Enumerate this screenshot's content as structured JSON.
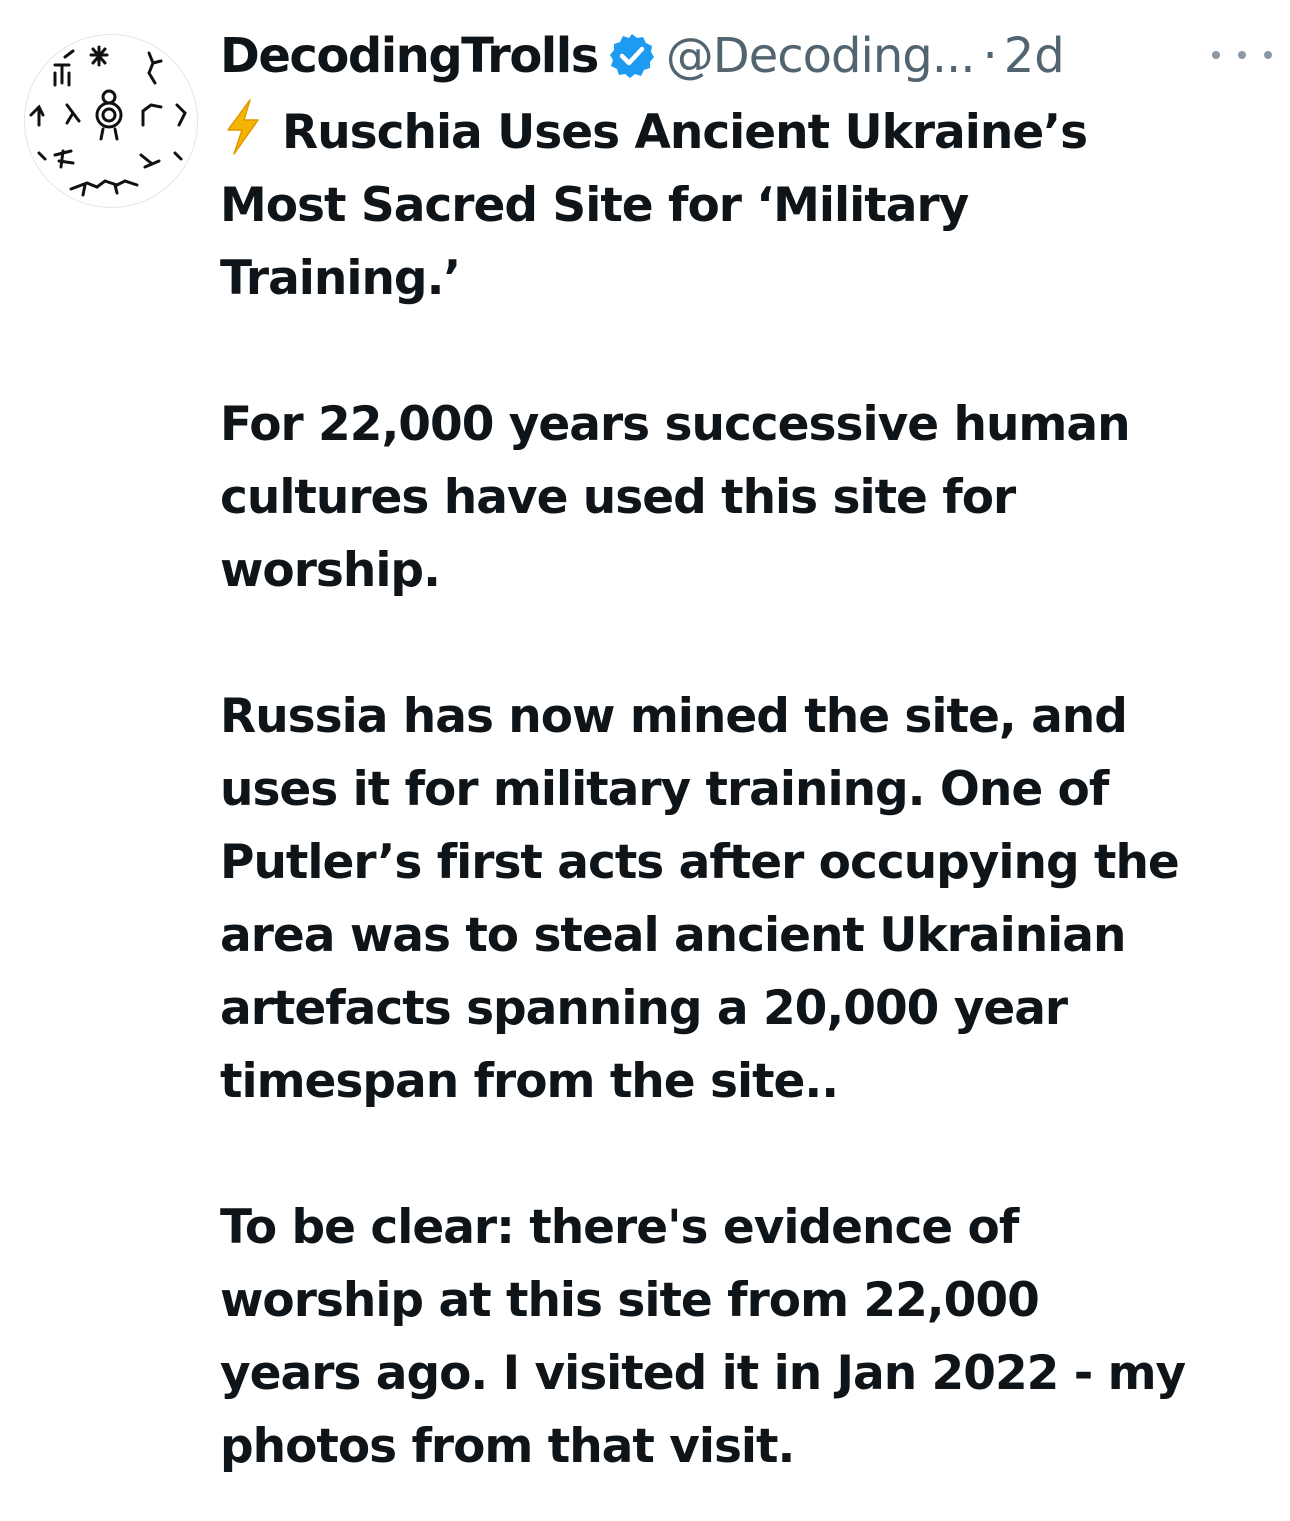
{
  "tweet": {
    "author": {
      "display_name": "DecodingTrolls",
      "handle": "@Decoding...",
      "verified": true,
      "verified_badge_color": "#1d9bf0"
    },
    "separator": "·",
    "timestamp": "2d",
    "more_icon": "ellipsis-icon",
    "emoji": "high-voltage-icon",
    "title_lines": [
      "Ruschia Uses Ancient Ukraine’s",
      "Most Sacred Site for ‘Military",
      "Training.’"
    ],
    "paragraph_1": [
      "For 22,000 years successive human",
      "cultures have used this site for",
      "worship."
    ],
    "paragraph_2": [
      "Russia has now mined the site, and",
      "uses it for military training. One of",
      "Putler’s first acts after occupying the",
      "area was to steal ancient Ukrainian",
      "artefacts spanning a 20,000 year",
      "timespan from the site.."
    ],
    "paragraph_3": [
      "To be clear: there's evidence of",
      "worship at this site from 22,000",
      "years ago. I visited it in Jan 2022 - my",
      "photos from that visit."
    ]
  }
}
